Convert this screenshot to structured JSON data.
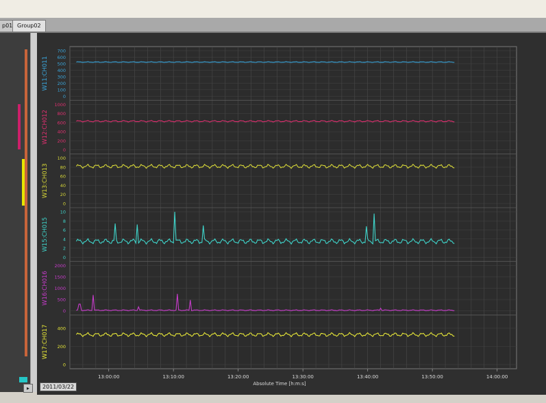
{
  "toolbar": {
    "items": [
      "",
      "",
      "",
      "",
      "",
      "",
      ""
    ]
  },
  "tabs": [
    {
      "label": "p01"
    },
    {
      "label": "Group02"
    }
  ],
  "date_label": "2011/03/22",
  "chart_data": {
    "type": "line",
    "x_label": "Absolute Time [h:m:s]",
    "x_ticks": [
      "13:00:00",
      "13:10:00",
      "13:20:00",
      "13:30:00",
      "13:40:00",
      "13:50:00",
      "14:00:00"
    ],
    "xlim": [
      "12:54:00",
      "14:03:00"
    ],
    "data_end": "13:53:30",
    "grid": true,
    "panels": [
      {
        "name": "W11:CH011",
        "color": "#3aa6dc",
        "ylim": [
          0,
          700
        ],
        "yticks": [
          "700",
          "600",
          "500",
          "400",
          "300",
          "200",
          "100",
          "0"
        ],
        "level": 525,
        "amp": 4,
        "spikes": []
      },
      {
        "name": "W12:CH012",
        "color": "#e03070",
        "ylim": [
          0,
          1000
        ],
        "yticks": [
          "1000",
          "800",
          "600",
          "400",
          "200",
          "0"
        ],
        "level": 630,
        "amp": 12,
        "spikes": []
      },
      {
        "name": "W13:CH013",
        "color": "#d8d838",
        "ylim": [
          0,
          100
        ],
        "yticks": [
          "100",
          "80",
          "60",
          "40",
          "20",
          "0"
        ],
        "level": 82,
        "amp": 3,
        "spikes": []
      },
      {
        "name": "W15:CH015",
        "color": "#3fd6cc",
        "ylim": [
          0,
          10
        ],
        "yticks": [
          "10",
          "8",
          "6",
          "4",
          "2",
          "0"
        ],
        "level": 3.5,
        "amp": 0.4,
        "spikes": [
          [
            "13:01:00",
            7.4
          ],
          [
            "13:04:20",
            7.2
          ],
          [
            "13:10:10",
            10.0
          ],
          [
            "13:14:40",
            7.0
          ],
          [
            "13:39:50",
            6.8
          ],
          [
            "13:41:00",
            9.6
          ]
        ]
      },
      {
        "name": "W16:CH016",
        "color": "#c83ccc",
        "ylim": [
          0,
          2000
        ],
        "yticks": [
          "2000",
          "1500",
          "1000",
          "500",
          "0"
        ],
        "level": 30,
        "amp": 15,
        "spikes": [
          [
            "12:55:30",
            300
          ],
          [
            "12:57:40",
            700
          ],
          [
            "13:04:40",
            180
          ],
          [
            "13:10:40",
            750
          ],
          [
            "13:12:40",
            480
          ],
          [
            "13:42:00",
            120
          ]
        ]
      },
      {
        "name": "W17:CH017",
        "color": "#e8e838",
        "ylim": [
          0,
          500
        ],
        "yticks": [
          "400",
          "200",
          "0"
        ],
        "level": 330,
        "amp": 15,
        "spikes": []
      }
    ]
  }
}
